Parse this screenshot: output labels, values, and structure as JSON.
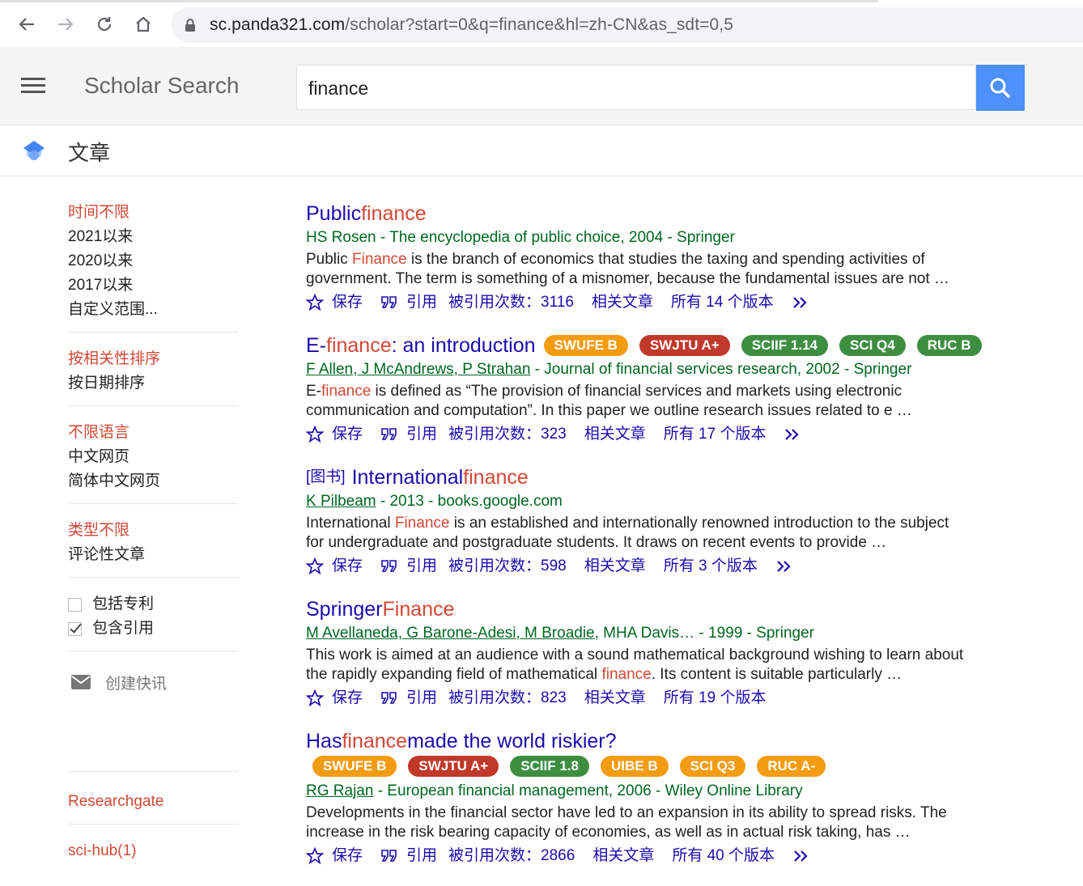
{
  "browser": {
    "url_host": "sc.panda321.com",
    "url_path": "/scholar?start=0&q=finance&hl=zh-CN&as_sdt=0,5"
  },
  "header": {
    "brand": "Scholar Search",
    "search_value": "finance"
  },
  "section": {
    "title": "文章"
  },
  "sidebar": {
    "time": [
      "时间不限",
      "2021以来",
      "2020以来",
      "2017以来",
      "自定义范围..."
    ],
    "sort": [
      "按相关性排序",
      "按日期排序"
    ],
    "lang": [
      "不限语言",
      "中文网页",
      "简体中文网页"
    ],
    "type": [
      "类型不限",
      "评论性文章"
    ],
    "checks": [
      {
        "label": "包括专利",
        "checked": false
      },
      {
        "label": "包含引用",
        "checked": true
      }
    ],
    "alert": "创建快讯",
    "links": [
      "Researchgate",
      "sci-hub(1)"
    ]
  },
  "actions": {
    "save": "保存",
    "cite": "引用",
    "related": "相关文章"
  },
  "colors": {
    "orange": "#f39c12",
    "red": "#c0392b",
    "green": "#3e8e41",
    "link": "#1a0dab",
    "meta": "#006621",
    "highlight": "#d14836"
  },
  "results": [
    {
      "type": "",
      "title_pre": "Public ",
      "title_hl": "finance",
      "title_post": "",
      "badges": [],
      "authors": "HS Rosen",
      "source": " - The encyclopedia of public choice, 2004 - Springer",
      "snip_a": "Public ",
      "snip_hl": "Finance",
      "snip_b": " is the branch of economics that studies the taxing and spending activities of government. The term is something of a misnomer, because the fundamental issues are not …",
      "cited": "被引用次数：3116",
      "versions": "所有 14 个版本"
    },
    {
      "type": "",
      "title_pre": "E-",
      "title_hl": "finance",
      "title_post": ": an introduction",
      "badges": [
        {
          "text": "SWUFE B",
          "color": "#f39c12"
        },
        {
          "text": "SWJTU A+",
          "color": "#c0392b"
        },
        {
          "text": "SCIIF 1.14",
          "color": "#3e8e41"
        },
        {
          "text": "SCI Q4",
          "color": "#3e8e41"
        },
        {
          "text": "RUC B",
          "color": "#3e8e41"
        }
      ],
      "authors": "F Allen, J McAndrews, P Strahan",
      "source": " - Journal of financial services research, 2002 - Springer",
      "snip_a": "E-",
      "snip_hl": "finance",
      "snip_b": " is defined as “The provision of financial services and markets using electronic communication and computation”. In this paper we outline research issues related to e …",
      "cited": "被引用次数：323",
      "versions": "所有 17 个版本"
    },
    {
      "type": "[图书]",
      "title_pre": "International ",
      "title_hl": "finance",
      "title_post": "",
      "badges": [],
      "authors": "K Pilbeam",
      "source": " - 2013 - books.google.com",
      "snip_a": "International ",
      "snip_hl": "Finance",
      "snip_b": " is an established and internationally renowned introduction to the subject for undergraduate and postgraduate students. It draws on recent events to provide …",
      "cited": "被引用次数：598",
      "versions": "所有 3 个版本"
    },
    {
      "type": "",
      "title_pre": "Springer ",
      "title_hl": "Finance",
      "title_post": "",
      "badges": [],
      "authors": "M Avellaneda, G Barone-Adesi, M Broadie",
      "source": ", MHA Davis… - 1999 - Springer",
      "snip_a": "This work is aimed at an audience with a sound mathematical background wishing to learn about the rapidly expanding field of mathematical ",
      "snip_hl": "finance",
      "snip_b": ". Its content is suitable particularly …",
      "cited": "被引用次数：823",
      "versions": "所有 19 个版本"
    },
    {
      "type": "",
      "title_pre": "Has ",
      "title_hl": "finance",
      "title_post": " made the world riskier?",
      "badges_below": [
        {
          "text": "SWUFE B",
          "color": "#f39c12"
        },
        {
          "text": "SWJTU A+",
          "color": "#c0392b"
        },
        {
          "text": "SCIIF 1.8",
          "color": "#3e8e41"
        },
        {
          "text": "UIBE B",
          "color": "#f39c12"
        },
        {
          "text": "SCI Q3",
          "color": "#f39c12"
        },
        {
          "text": "RUC A-",
          "color": "#f39c12"
        }
      ],
      "authors": "RG Rajan",
      "source": " - European financial management, 2006 - Wiley Online Library",
      "snip_a": "Developments in the financial sector have led to an expansion in its ability to spread risks. The increase in the risk bearing capacity of economies, as well as in actual risk taking, has …",
      "snip_hl": "",
      "snip_b": "",
      "cited": "被引用次数：2866",
      "versions": "所有 40 个版本"
    }
  ]
}
